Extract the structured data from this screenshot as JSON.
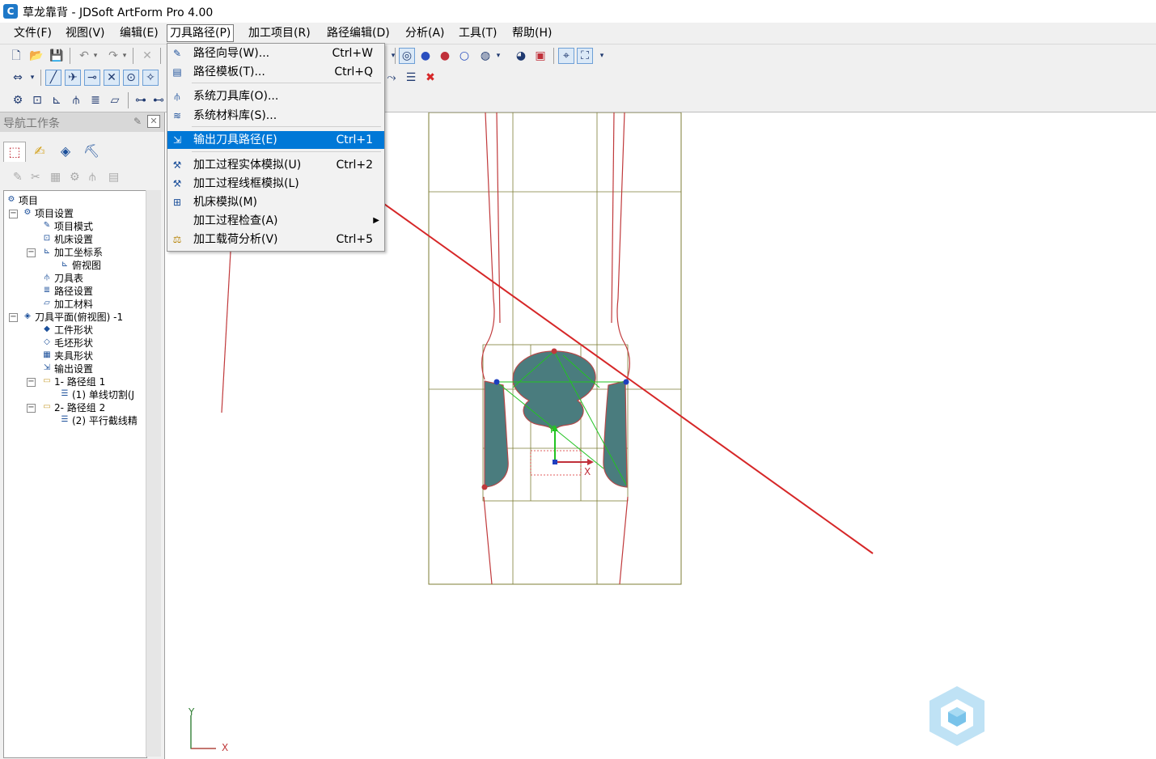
{
  "window": {
    "title": "草龙靠背 - JDSoft ArtForm Pro 4.00",
    "app_icon": "artform-logo-icon"
  },
  "menubar": {
    "items": [
      {
        "label": "文件(F)"
      },
      {
        "label": "视图(V)"
      },
      {
        "label": "编辑(E)"
      },
      {
        "label": "刀具路径(P)"
      },
      {
        "label": "加工项目(R)"
      },
      {
        "label": "路径编辑(D)"
      },
      {
        "label": "分析(A)"
      },
      {
        "label": "工具(T)"
      },
      {
        "label": "帮助(H)"
      }
    ],
    "open_menu": "刀具路径(P)"
  },
  "dropdown": {
    "items": [
      {
        "label": "路径向导(W)...",
        "shortcut": "Ctrl+W",
        "icon": "wizard-icon"
      },
      {
        "label": "路径模板(T)...",
        "shortcut": "Ctrl+Q",
        "icon": "template-icon"
      },
      {
        "label": "系统刀具库(O)...",
        "shortcut": "",
        "icon": "tool-library-icon"
      },
      {
        "label": "系统材料库(S)...",
        "shortcut": "",
        "icon": "material-library-icon"
      },
      {
        "label": "输出刀具路径(E)",
        "shortcut": "Ctrl+1",
        "icon": "export-path-icon",
        "highlighted": true
      },
      {
        "label": "加工过程实体模拟(U)",
        "shortcut": "Ctrl+2",
        "icon": "solid-sim-icon"
      },
      {
        "label": "加工过程线框模拟(L)",
        "shortcut": "",
        "icon": "wireframe-sim-icon"
      },
      {
        "label": "机床模拟(M)",
        "shortcut": "",
        "icon": "machine-sim-icon"
      },
      {
        "label": "加工过程检查(A)",
        "shortcut": "",
        "icon": "",
        "submenu": true
      },
      {
        "label": "加工载荷分析(V)",
        "shortcut": "Ctrl+5",
        "icon": "load-analysis-icon"
      }
    ]
  },
  "navpanel": {
    "title": "导航工作条",
    "tabs": [
      "project-tab-icon",
      "edit-tab-icon",
      "layer-tab-icon",
      "tool-tab-icon"
    ],
    "tree": [
      {
        "label": "项目",
        "level": 0,
        "expander": ""
      },
      {
        "label": "项目设置",
        "level": 1,
        "expander": "⊟"
      },
      {
        "label": "项目模式",
        "level": 2,
        "expander": ""
      },
      {
        "label": "机床设置",
        "level": 2,
        "expander": ""
      },
      {
        "label": "加工坐标系",
        "level": 2,
        "expander": "⊟"
      },
      {
        "label": "俯视图",
        "level": 3,
        "expander": ""
      },
      {
        "label": "刀具表",
        "level": 2,
        "expander": ""
      },
      {
        "label": "路径设置",
        "level": 2,
        "expander": ""
      },
      {
        "label": "加工材料",
        "level": 2,
        "expander": ""
      },
      {
        "label": "刀具平面(俯视图) -1",
        "level": 1,
        "expander": "⊟"
      },
      {
        "label": "工件形状",
        "level": 2,
        "expander": ""
      },
      {
        "label": "毛坯形状",
        "level": 2,
        "expander": ""
      },
      {
        "label": "夹具形状",
        "level": 2,
        "expander": ""
      },
      {
        "label": "输出设置",
        "level": 2,
        "expander": ""
      },
      {
        "label": "1- 路径组 1",
        "level": 2,
        "expander": "⊟"
      },
      {
        "label": "(1) 单线切割(J",
        "level": 3,
        "expander": ""
      },
      {
        "label": "2- 路径组 2",
        "level": 2,
        "expander": "⊟"
      },
      {
        "label": "(2) 平行截线精",
        "level": 3,
        "expander": ""
      }
    ]
  },
  "viewport": {
    "axis_x": "X",
    "axis_y": "Y",
    "colors": {
      "profile": "#c0393b",
      "grid": "#7d7d36",
      "fill": "#4a7c7e",
      "annotation": "#d62728",
      "toolpath": "#22c322"
    }
  }
}
